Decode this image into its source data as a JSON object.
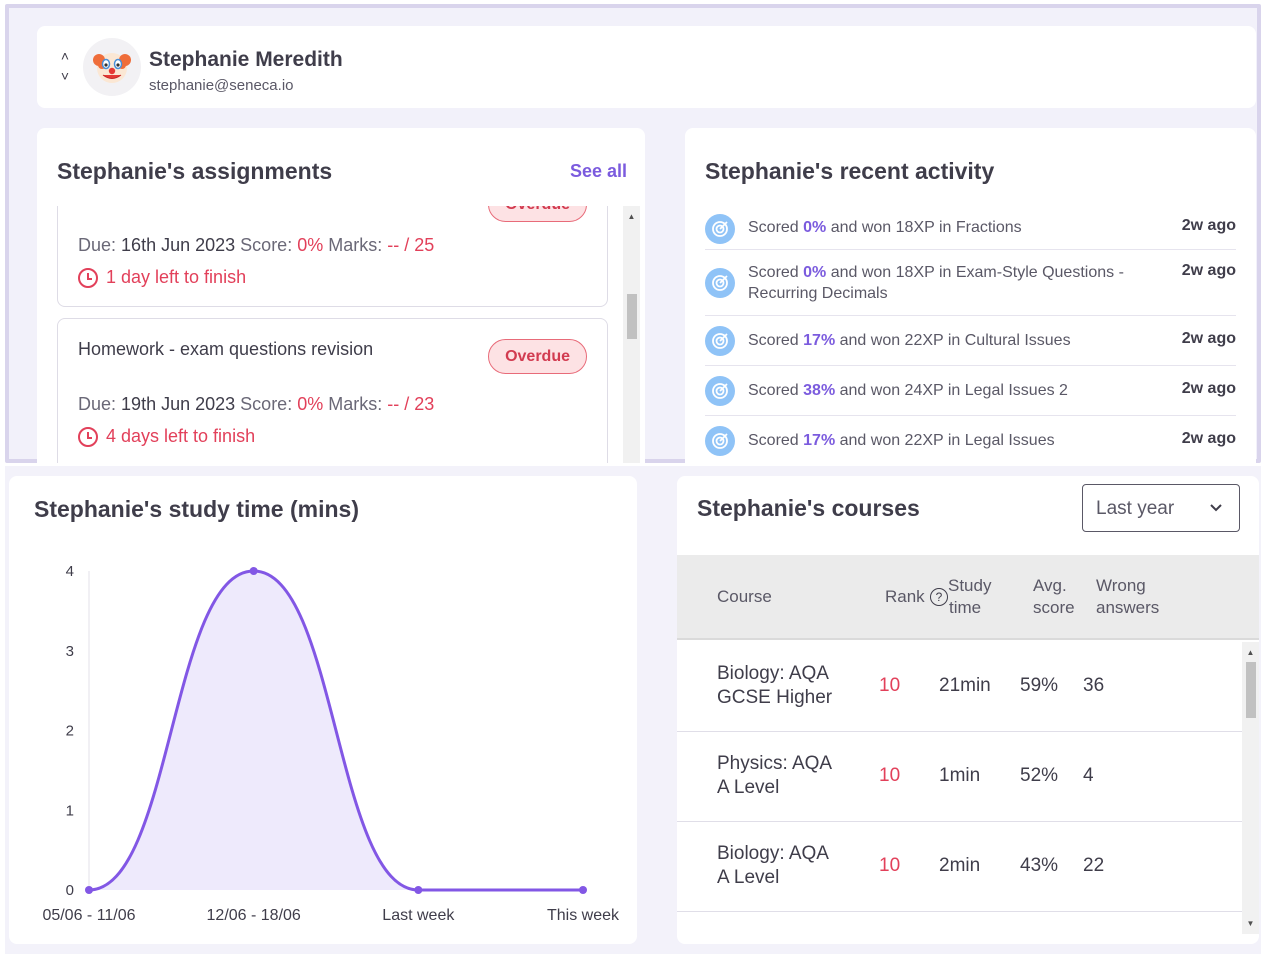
{
  "header": {
    "user_name": "Stephanie Meredith",
    "user_email": "stephanie@seneca.io",
    "avatar_icon": "clown-face-icon",
    "up_arrow": "˄",
    "down_arrow": "˅"
  },
  "assignments": {
    "title": "Stephanie's assignments",
    "see_all": "See all",
    "items": [
      {
        "badge": "Overdue",
        "due_label": "Due:",
        "due": "16th Jun 2023",
        "score_label": "Score:",
        "score": "0%",
        "marks_label": "Marks:",
        "marks": "-- / 25",
        "time_left": "1 day left to finish"
      },
      {
        "title": "Homework - exam questions revision",
        "badge": "Overdue",
        "due_label": "Due:",
        "due": "19th Jun 2023",
        "score_label": "Score:",
        "score": "0%",
        "marks_label": "Marks:",
        "marks": "-- / 23",
        "time_left": "4 days left to finish"
      }
    ]
  },
  "activity": {
    "title": "Stephanie's recent activity",
    "items": [
      {
        "pre": "Scored ",
        "pct": "0%",
        "post": " and won 18XP in Fractions",
        "time": "2w ago"
      },
      {
        "pre": "Scored ",
        "pct": "0%",
        "post": " and won 18XP in Exam-Style Questions - Recurring Decimals",
        "time": "2w ago"
      },
      {
        "pre": "Scored ",
        "pct": "17%",
        "post": " and won 22XP in Cultural Issues",
        "time": "2w ago"
      },
      {
        "pre": "Scored ",
        "pct": "38%",
        "post": " and won 24XP in Legal Issues 2",
        "time": "2w ago"
      },
      {
        "pre": "Scored ",
        "pct": "17%",
        "post": " and won 22XP in Legal Issues",
        "time": "2w ago"
      }
    ]
  },
  "study_chart_title": "Stephanie's study time (mins)",
  "chart_data": {
    "type": "area",
    "title": "Stephanie's study time (mins)",
    "categories": [
      "05/06 - 11/06",
      "12/06 - 18/06",
      "Last week",
      "This week"
    ],
    "values": [
      0,
      4,
      0,
      0
    ],
    "ylim": [
      0,
      4
    ],
    "yticks": [
      "0",
      "1",
      "2",
      "3",
      "4"
    ],
    "grid": false,
    "colors": {
      "line": "#8257e5",
      "fill": "#eeeafc"
    }
  },
  "courses": {
    "title": "Stephanie's courses",
    "period": "Last year",
    "headers": {
      "course": "Course",
      "rank": "Rank",
      "rank_help": "?",
      "study_1": "Study",
      "study_2": "time",
      "avg_1": "Avg.",
      "avg_2": "score",
      "wrong_1": "Wrong",
      "wrong_2": "answers"
    },
    "rows": [
      {
        "course_1": "Biology: AQA",
        "course_2": "GCSE Higher",
        "rank": "10",
        "study": "21min",
        "avg": "59%",
        "wrong": "36"
      },
      {
        "course_1": "Physics: AQA",
        "course_2": "A Level",
        "rank": "10",
        "study": "1min",
        "avg": "52%",
        "wrong": "4"
      },
      {
        "course_1": "Biology: AQA",
        "course_2": "A Level",
        "rank": "10",
        "study": "2min",
        "avg": "43%",
        "wrong": "22"
      }
    ]
  },
  "colors": {
    "accent": "#7b5bde",
    "danger": "#e2405a",
    "frame": "#d9d4ec"
  }
}
